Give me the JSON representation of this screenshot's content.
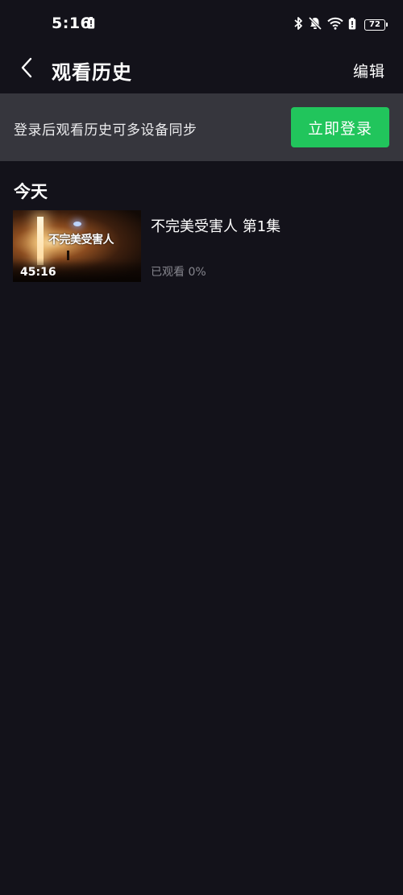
{
  "status_bar": {
    "time": "5:16",
    "battery": "72",
    "icons": [
      "sim-alert-icon",
      "bluetooth-icon",
      "mute-bell-icon",
      "wifi-icon",
      "battery-alert-icon",
      "battery-icon"
    ]
  },
  "header": {
    "title": "观看历史",
    "edit_label": "编辑",
    "back_icon": "chevron-left-icon"
  },
  "login_banner": {
    "hint": "登录后观看历史可多设备同步",
    "button_label": "立即登录",
    "button_color": "#21c55c"
  },
  "section": {
    "title": "今天"
  },
  "history": [
    {
      "title": "不完美受害人 第1集",
      "thumbnail_title": "不完美受害人",
      "duration": "45:16",
      "progress": "已观看 0%"
    }
  ],
  "colors": {
    "background": "#13121a",
    "banner": "#36363d",
    "muted_text": "#86868e"
  }
}
